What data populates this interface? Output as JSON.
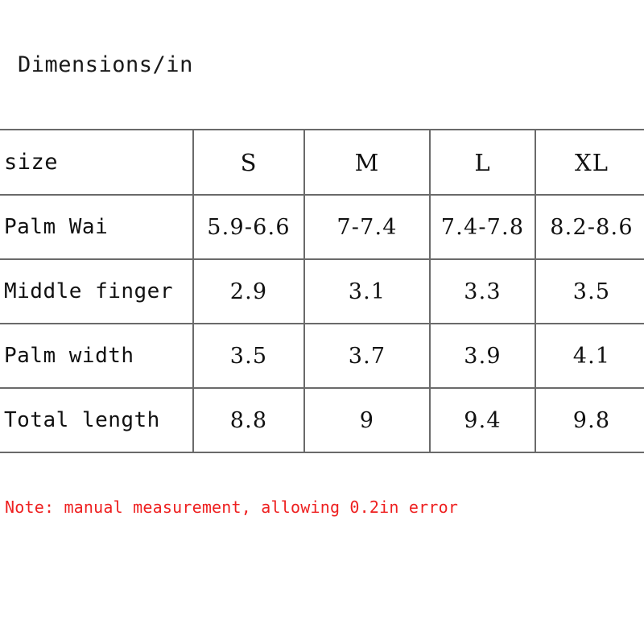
{
  "title": "Dimensions/in",
  "note": {
    "text": "Note: manual measurement, allowing 0.2in error",
    "color": "#ee2020"
  },
  "colors": {
    "border": "#6a6a6a",
    "text": "#111111",
    "note_red": "#ee2020",
    "background": "#ffffff"
  },
  "table": {
    "header": {
      "label": "size",
      "sizes": [
        "S",
        "M",
        "L",
        "XL"
      ]
    },
    "rows": [
      {
        "label": "Palm Wai",
        "values": [
          "5.9-6.6",
          "7-7.4",
          "7.4-7.8",
          "8.2-8.6"
        ]
      },
      {
        "label": "Middle finger",
        "values": [
          "2.9",
          "3.1",
          "3.3",
          "3.5"
        ]
      },
      {
        "label": "Palm width",
        "values": [
          "3.5",
          "3.7",
          "3.9",
          "4.1"
        ]
      },
      {
        "label": "Total length",
        "values": [
          "8.8",
          "9",
          "9.4",
          "9.8"
        ]
      }
    ]
  },
  "chart_data": {
    "type": "table",
    "title": "Dimensions/in",
    "columns": [
      "size",
      "S",
      "M",
      "L",
      "XL"
    ],
    "rows": [
      [
        "Palm Wai",
        "5.9-6.6",
        "7-7.4",
        "7.4-7.8",
        "8.2-8.6"
      ],
      [
        "Middle finger",
        "2.9",
        "3.1",
        "3.3",
        "3.5"
      ],
      [
        "Palm width",
        "3.5",
        "3.7",
        "3.9",
        "4.1"
      ],
      [
        "Total length",
        "8.8",
        "9",
        "9.4",
        "9.8"
      ]
    ],
    "units": "in",
    "annotations": [
      "Note: manual measurement, allowing 0.2in error"
    ]
  }
}
